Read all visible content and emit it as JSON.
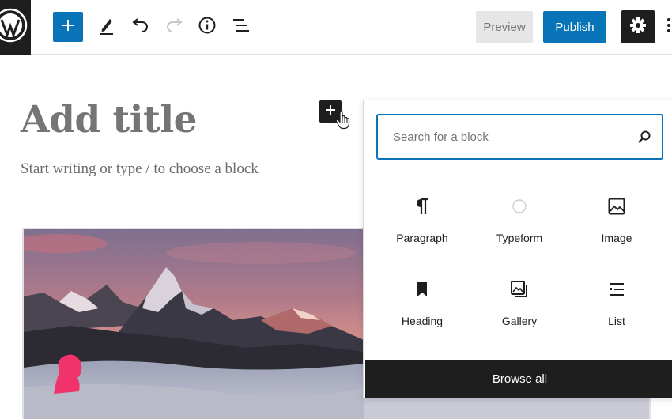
{
  "toolbar": {
    "icons": [
      "wordpress-logo-icon",
      "plus-icon",
      "pencil-icon",
      "undo-icon",
      "redo-icon",
      "info-icon",
      "list-view-icon",
      "gear-icon",
      "more-vertical-icon"
    ],
    "preview_label": "Preview",
    "publish_label": "Publish"
  },
  "editor": {
    "title_placeholder": "Add title",
    "appender_text": "Start writing or type / to choose a block"
  },
  "inserter": {
    "search_placeholder": "Search for a block",
    "blocks": [
      {
        "label": "Paragraph",
        "icon": "paragraph-icon"
      },
      {
        "label": "Typeform",
        "icon": "typeform-icon"
      },
      {
        "label": "Image",
        "icon": "image-icon"
      },
      {
        "label": "Heading",
        "icon": "heading-bookmark-icon"
      },
      {
        "label": "Gallery",
        "icon": "gallery-icon"
      },
      {
        "label": "List",
        "icon": "list-icon"
      }
    ],
    "browse_all_label": "Browse all"
  },
  "colors": {
    "accent": "#0a74b9",
    "dark": "#1e1e1e",
    "preview_bg": "#e6e6e6",
    "avatar_pink": "#f0346b"
  }
}
